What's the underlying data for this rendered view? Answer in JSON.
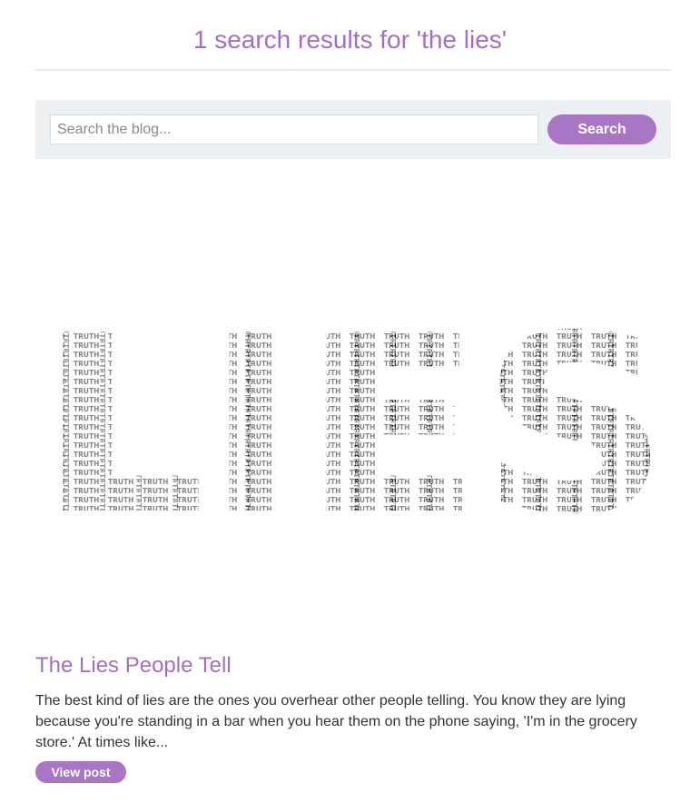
{
  "header": {
    "title": "1 search results for 'the lies'"
  },
  "search": {
    "placeholder": "Search the blog...",
    "value": "",
    "button_label": "Search"
  },
  "post": {
    "image_word": "LIES",
    "image_fill_word": "TRUTH",
    "title": "The Lies People Tell",
    "excerpt": "The best kind of lies are the ones you overhear other people telling. You know they are lying because you're standing in a bar when you hear them on the phone saying, 'I'm in the grocery store.' At times like...",
    "view_label": "View post"
  },
  "colors": {
    "accent": "#a56ec4",
    "button": "#a876c4",
    "search_bar_bg": "#edf0f2",
    "text": "#333333"
  }
}
